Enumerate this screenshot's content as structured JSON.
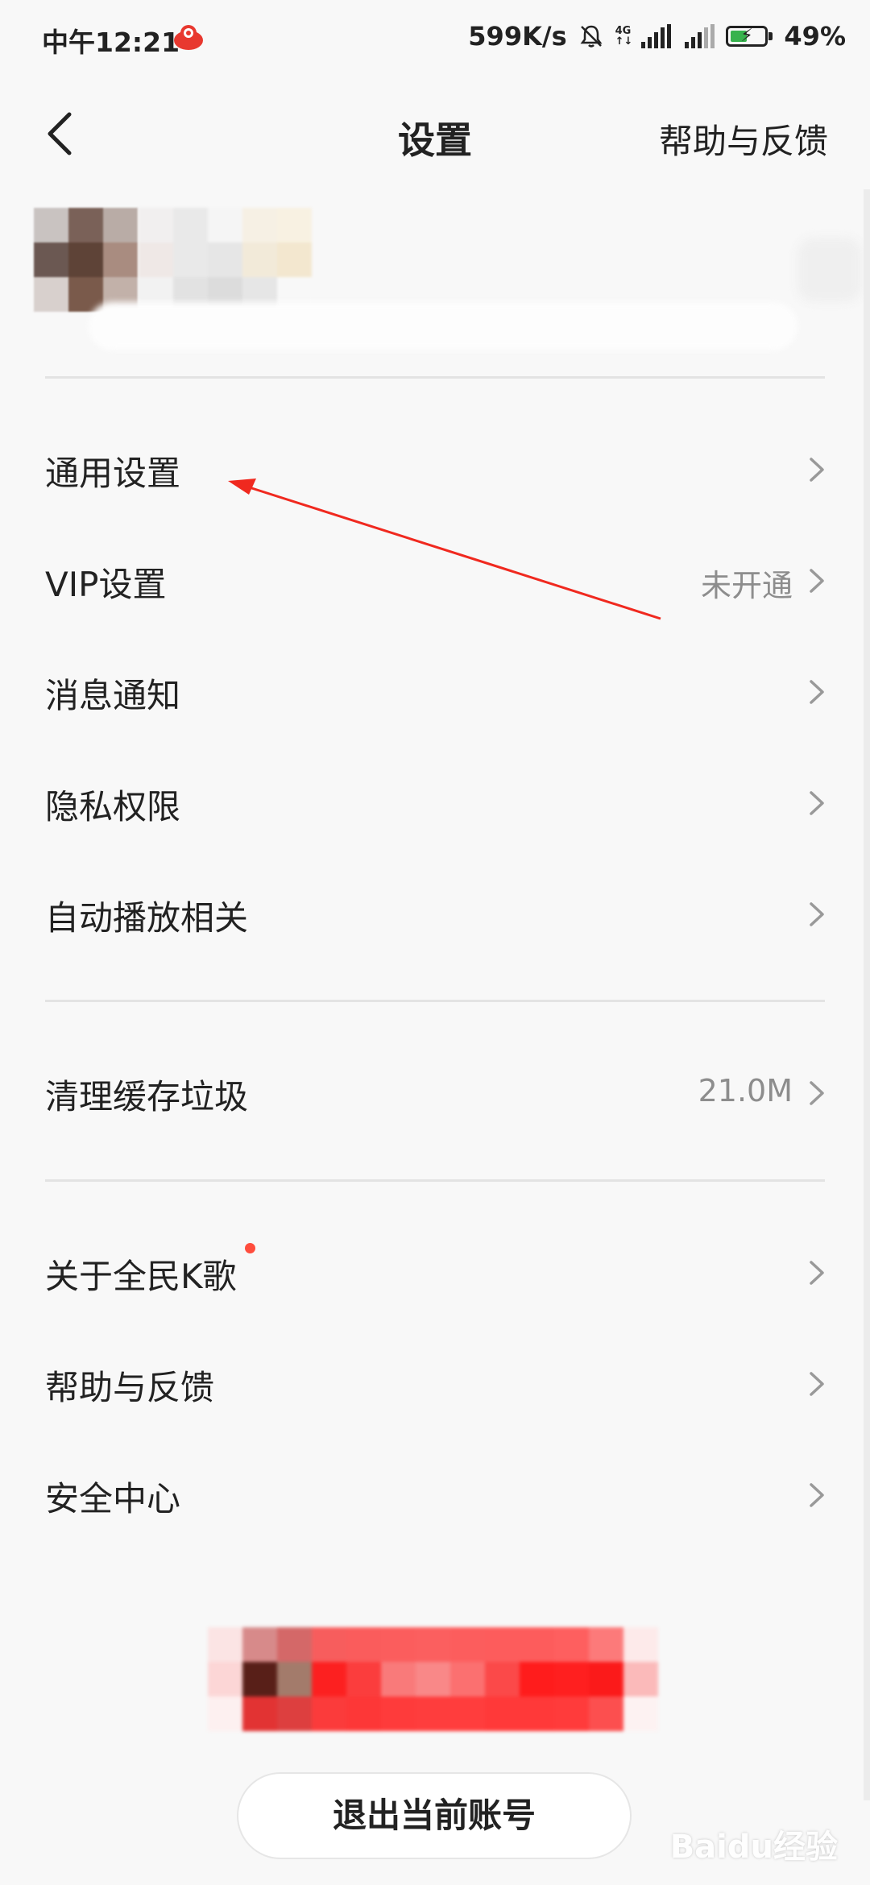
{
  "status": {
    "time": "中午12:21",
    "network_speed": "599K/s",
    "network_type": "4G",
    "battery": "49%",
    "battery_level": 0.49,
    "colors": {
      "battery_fill": "#37b24d"
    }
  },
  "header": {
    "back_icon": "chevron-left-icon",
    "title": "设置",
    "right_link": "帮助与反馈"
  },
  "menu": {
    "group1": [
      {
        "label": "通用设置",
        "value": ""
      },
      {
        "label": "VIP设置",
        "value": "未开通"
      },
      {
        "label": "消息通知",
        "value": ""
      },
      {
        "label": "隐私权限",
        "value": ""
      },
      {
        "label": "自动播放相关",
        "value": ""
      }
    ],
    "group2": [
      {
        "label": "清理缓存垃圾",
        "value": "21.0M"
      }
    ],
    "group3": [
      {
        "label": "关于全民K歌",
        "value": "",
        "badge_dot": true
      },
      {
        "label": "帮助与反馈",
        "value": ""
      },
      {
        "label": "安全中心",
        "value": ""
      }
    ]
  },
  "logout_button": "退出当前账号",
  "watermark": "Baidu经验",
  "colors": {
    "accent_red": "#ff2a2a",
    "dot_color": "#ff4d3d",
    "arrow_color": "#f0291f"
  }
}
